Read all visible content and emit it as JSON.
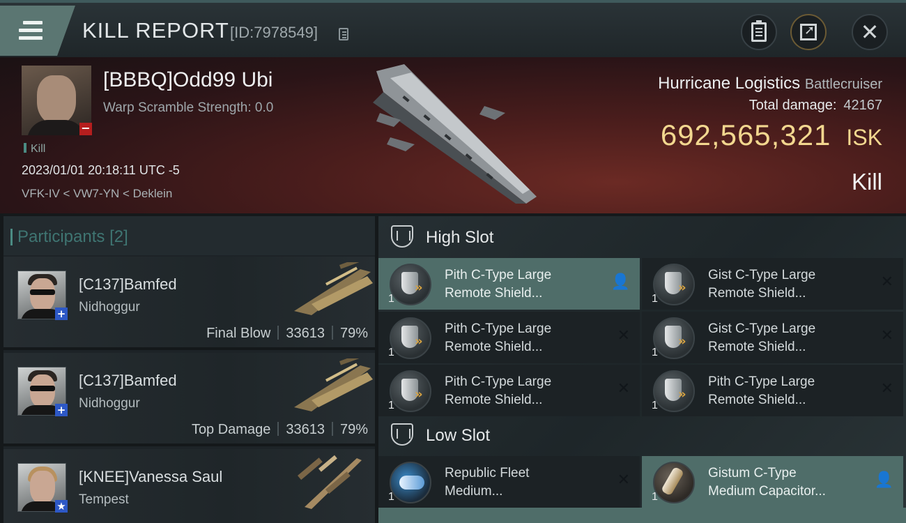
{
  "header": {
    "title": "KILL REPORT",
    "report_id": "[ID:7978549]"
  },
  "victim": {
    "name": "[BBBQ]Odd99 Ubi",
    "warp_scramble": "Warp Scramble Strength: 0.0",
    "tag": "Kill",
    "timestamp": "2023/01/01 20:18:11 UTC -5",
    "location": "VFK-IV < VW7-YN < Deklein",
    "ship_name": "Hurricane Logistics",
    "ship_class": "Battlecruiser",
    "total_damage_label": "Total damage:",
    "total_damage_value": "42167",
    "isk_value": "692,565,321",
    "isk_unit": "ISK",
    "result": "Kill"
  },
  "participants": {
    "title": "Participants",
    "count": "[2]",
    "rows": [
      {
        "name": "[C137]Bamfed",
        "ship": "Nidhoggur",
        "role": "Final Blow",
        "damage": "33613",
        "percent": "79%",
        "badge": "+"
      },
      {
        "name": "[C137]Bamfed",
        "ship": "Nidhoggur",
        "role": "Top Damage",
        "damage": "33613",
        "percent": "79%",
        "badge": "+"
      },
      {
        "name": "[KNEE]Vanessa Saul",
        "ship": "Tempest",
        "role": "",
        "damage": "",
        "percent": "",
        "badge": "★"
      }
    ]
  },
  "slots": {
    "high": {
      "label": "High Slot",
      "items": [
        {
          "name_line1": "Pith C-Type Large",
          "name_line2": "Remote Shield...",
          "qty": "1",
          "action": "person",
          "highlight": true
        },
        {
          "name_line1": "Gist C-Type Large",
          "name_line2": "Remote Shield...",
          "qty": "1",
          "action": "x",
          "highlight": false
        },
        {
          "name_line1": "Pith C-Type Large",
          "name_line2": "Remote Shield...",
          "qty": "1",
          "action": "x",
          "highlight": false
        },
        {
          "name_line1": "Gist C-Type Large",
          "name_line2": "Remote Shield...",
          "qty": "1",
          "action": "x",
          "highlight": false
        },
        {
          "name_line1": "Pith C-Type Large",
          "name_line2": "Remote Shield...",
          "qty": "1",
          "action": "x",
          "highlight": false
        },
        {
          "name_line1": "Pith C-Type Large",
          "name_line2": "Remote Shield...",
          "qty": "1",
          "action": "x",
          "highlight": false
        }
      ]
    },
    "low": {
      "label": "Low Slot",
      "items": [
        {
          "name_line1": "Republic Fleet",
          "name_line2": "Medium...",
          "qty": "1",
          "action": "x",
          "highlight": false
        },
        {
          "name_line1": "Gistum C-Type",
          "name_line2": "Medium Capacitor...",
          "qty": "1",
          "action": "person",
          "highlight": true
        }
      ]
    }
  },
  "colors": {
    "accent_teal": "#4f6d69",
    "isk_gold": "#f2d78f",
    "badge_red": "#b51e1e",
    "badge_blue": "#2d58c6"
  },
  "icons": {
    "menu": "menu-icon",
    "copy": "copy-icon",
    "clipboard": "clipboard-icon",
    "share": "share-icon",
    "close": "close-icon"
  }
}
